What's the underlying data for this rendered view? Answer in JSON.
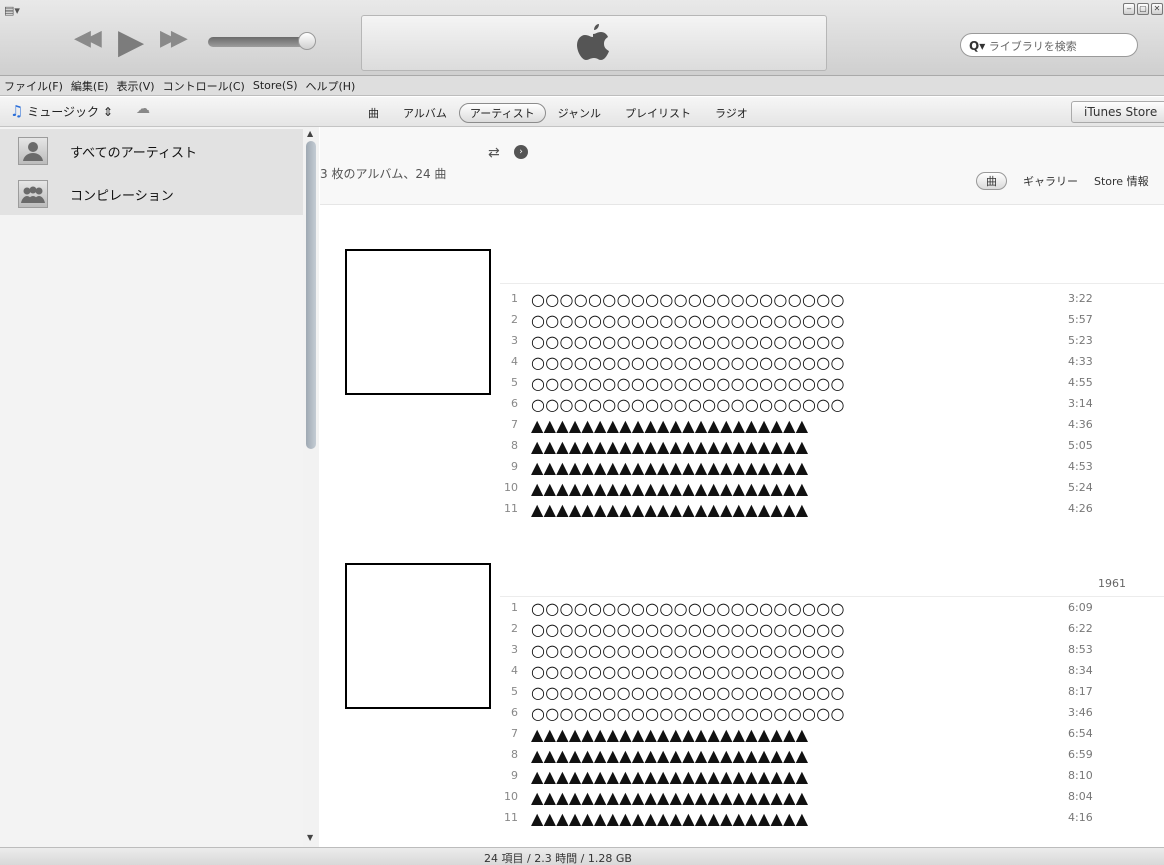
{
  "window": {
    "menu_icon": "▤▾",
    "controls": [
      "‒",
      "▢",
      "✕"
    ]
  },
  "player": {
    "prev_icon": "◀◀",
    "play_icon": "▶",
    "next_icon": "▶▶",
    "volume": 0.95
  },
  "search": {
    "placeholder": "ライブラリを検索",
    "icon": "Q▾"
  },
  "menubar": {
    "items": [
      "ファイル(F)",
      "編集(E)",
      "表示(V)",
      "コントロール(C)",
      "Store(S)",
      "ヘルプ(H)"
    ]
  },
  "nav": {
    "library": "ミュージック ⇕",
    "tabs": [
      "曲",
      "アルバム",
      "アーティスト",
      "ジャンル",
      "プレイリスト",
      "ラジオ"
    ],
    "active_tab": "アーティスト",
    "store_button": "iTunes Store"
  },
  "sidebar": {
    "items": [
      {
        "label": "すべてのアーティスト",
        "icon": "artist-icon"
      },
      {
        "label": "コンピレーション",
        "icon": "group-icon"
      }
    ]
  },
  "main": {
    "summary": "3 枚のアルバム、24 曲",
    "views": [
      "曲",
      "ギャラリー",
      "Store 情報"
    ],
    "active_view": "曲"
  },
  "albums": [
    {
      "year": "",
      "tracks": [
        {
          "num": "1",
          "title": "○○○○○○○○○○○○○○○○○○○○○○",
          "dur": "3:22"
        },
        {
          "num": "2",
          "title": "○○○○○○○○○○○○○○○○○○○○○○",
          "dur": "5:57"
        },
        {
          "num": "3",
          "title": "○○○○○○○○○○○○○○○○○○○○○○",
          "dur": "5:23"
        },
        {
          "num": "4",
          "title": "○○○○○○○○○○○○○○○○○○○○○○",
          "dur": "4:33"
        },
        {
          "num": "5",
          "title": "○○○○○○○○○○○○○○○○○○○○○○",
          "dur": "4:55"
        },
        {
          "num": "6",
          "title": "○○○○○○○○○○○○○○○○○○○○○○",
          "dur": "3:14"
        },
        {
          "num": "7",
          "title": "▲▲▲▲▲▲▲▲▲▲▲▲▲▲▲▲▲▲▲▲▲▲",
          "dur": "4:36"
        },
        {
          "num": "8",
          "title": "▲▲▲▲▲▲▲▲▲▲▲▲▲▲▲▲▲▲▲▲▲▲",
          "dur": "5:05"
        },
        {
          "num": "9",
          "title": "▲▲▲▲▲▲▲▲▲▲▲▲▲▲▲▲▲▲▲▲▲▲",
          "dur": "4:53"
        },
        {
          "num": "10",
          "title": "▲▲▲▲▲▲▲▲▲▲▲▲▲▲▲▲▲▲▲▲▲▲",
          "dur": "5:24"
        },
        {
          "num": "11",
          "title": "▲▲▲▲▲▲▲▲▲▲▲▲▲▲▲▲▲▲▲▲▲▲",
          "dur": "4:26"
        }
      ]
    },
    {
      "year": "1961",
      "tracks": [
        {
          "num": "1",
          "title": "○○○○○○○○○○○○○○○○○○○○○○",
          "dur": "6:09"
        },
        {
          "num": "2",
          "title": "○○○○○○○○○○○○○○○○○○○○○○",
          "dur": "6:22"
        },
        {
          "num": "3",
          "title": "○○○○○○○○○○○○○○○○○○○○○○",
          "dur": "8:53"
        },
        {
          "num": "4",
          "title": "○○○○○○○○○○○○○○○○○○○○○○",
          "dur": "8:34"
        },
        {
          "num": "5",
          "title": "○○○○○○○○○○○○○○○○○○○○○○",
          "dur": "8:17"
        },
        {
          "num": "6",
          "title": "○○○○○○○○○○○○○○○○○○○○○○",
          "dur": "3:46"
        },
        {
          "num": "7",
          "title": "▲▲▲▲▲▲▲▲▲▲▲▲▲▲▲▲▲▲▲▲▲▲",
          "dur": "6:54"
        },
        {
          "num": "8",
          "title": "▲▲▲▲▲▲▲▲▲▲▲▲▲▲▲▲▲▲▲▲▲▲",
          "dur": "6:59"
        },
        {
          "num": "9",
          "title": "▲▲▲▲▲▲▲▲▲▲▲▲▲▲▲▲▲▲▲▲▲▲",
          "dur": "8:10"
        },
        {
          "num": "10",
          "title": "▲▲▲▲▲▲▲▲▲▲▲▲▲▲▲▲▲▲▲▲▲▲",
          "dur": "8:04"
        },
        {
          "num": "11",
          "title": "▲▲▲▲▲▲▲▲▲▲▲▲▲▲▲▲▲▲▲▲▲▲",
          "dur": "4:16"
        }
      ]
    }
  ],
  "status": {
    "text": "24 項目 / 2.3 時間 / 1.28 GB"
  }
}
